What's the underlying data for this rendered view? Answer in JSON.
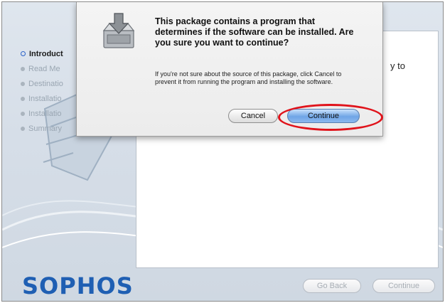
{
  "sidebar": {
    "steps": [
      {
        "label": "Introduct",
        "active": true
      },
      {
        "label": "Read Me",
        "active": false
      },
      {
        "label": "Destinatio",
        "active": false
      },
      {
        "label": "Installatio",
        "active": false
      },
      {
        "label": "Installatio",
        "active": false
      },
      {
        "label": "Summary",
        "active": false
      }
    ]
  },
  "main": {
    "visible_text": "y to"
  },
  "logo": {
    "text": "SOPHOS",
    "color": "#1f5fb3"
  },
  "footer": {
    "back_label": "Go Back",
    "continue_label": "Continue"
  },
  "dialog": {
    "icon": "package-install-icon",
    "title": "This package contains a program that determines if the software can be installed.  Are you sure you want to continue?",
    "body": "If you're not sure about the source of this package, click Cancel to prevent it from running the program and installing the software.",
    "cancel_label": "Cancel",
    "continue_label": "Continue"
  },
  "annotation": {
    "color": "#e0131b",
    "target": "Continue"
  }
}
